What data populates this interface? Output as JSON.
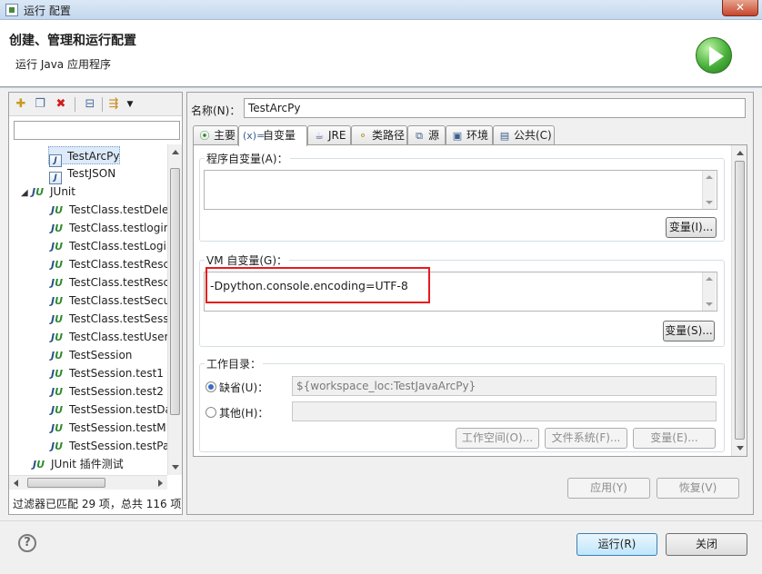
{
  "window": {
    "title": "运行 配置",
    "close_label": "✕"
  },
  "header": {
    "title": "创建、管理和运行配置",
    "subtitle": "运行 Java 应用程序"
  },
  "left": {
    "filter_placeholder": "",
    "tree": [
      {
        "label": "TestArcPy",
        "icon": "java-app-icon",
        "selected": true
      },
      {
        "label": "TestJSON",
        "icon": "java-app-icon"
      },
      {
        "label": "JUnit",
        "icon": "junit-icon",
        "expander": "◢"
      },
      {
        "label": "TestClass.testDele",
        "icon": "junit-icon"
      },
      {
        "label": "TestClass.testlogin",
        "icon": "junit-icon"
      },
      {
        "label": "TestClass.testLogi",
        "icon": "junit-icon"
      },
      {
        "label": "TestClass.testResc",
        "icon": "junit-icon"
      },
      {
        "label": "TestClass.testResc",
        "icon": "junit-icon"
      },
      {
        "label": "TestClass.testSecu",
        "icon": "junit-icon"
      },
      {
        "label": "TestClass.testSess",
        "icon": "junit-icon"
      },
      {
        "label": "TestClass.testUser",
        "icon": "junit-icon"
      },
      {
        "label": "TestSession",
        "icon": "junit-icon"
      },
      {
        "label": "TestSession.test1",
        "icon": "junit-icon"
      },
      {
        "label": "TestSession.test2",
        "icon": "junit-icon"
      },
      {
        "label": "TestSession.testDa",
        "icon": "junit-icon"
      },
      {
        "label": "TestSession.testM",
        "icon": "junit-icon"
      },
      {
        "label": "TestSession.testPa",
        "icon": "junit-icon"
      },
      {
        "label": "JUnit 插件测试",
        "icon": "junit-plugin-icon"
      }
    ],
    "filter_status": "过滤器已匹配 29 项，总共 116 项"
  },
  "config": {
    "name_label": "名称(N)：",
    "name_value": "TestArcPy",
    "tabs": [
      {
        "label": "主要",
        "icon": "main-tab-icon"
      },
      {
        "label": "自变量",
        "icon": "arguments-tab-icon",
        "active": true
      },
      {
        "label": "JRE",
        "icon": "jre-tab-icon"
      },
      {
        "label": "类路径",
        "icon": "classpath-tab-icon"
      },
      {
        "label": "源",
        "icon": "source-tab-icon"
      },
      {
        "label": "环境",
        "icon": "environment-tab-icon"
      },
      {
        "label": "公共(C)",
        "icon": "common-tab-icon"
      }
    ],
    "program_args_label": "程序自变量(A)：",
    "program_args_value": "",
    "program_vars_button": "变量(I)...",
    "vm_args_label": "VM 自变量(G)：",
    "vm_args_value": "-Dpython.console.encoding=UTF-8",
    "vm_vars_button": "变量(S)...",
    "workdir_label": "工作目录：",
    "default_label": "缺省(U)：",
    "default_value": "${workspace_loc:TestJavaArcPy}",
    "other_label": "其他(H)：",
    "other_value": "",
    "workspace_button": "工作空间(O)...",
    "filesystem_button": "文件系统(F)...",
    "variables_button": "变量(E)...",
    "apply_button": "应用(Y)",
    "revert_button": "恢复(V)"
  },
  "footer": {
    "run_button": "运行(R)",
    "close_button": "关闭",
    "help_label": "?"
  }
}
